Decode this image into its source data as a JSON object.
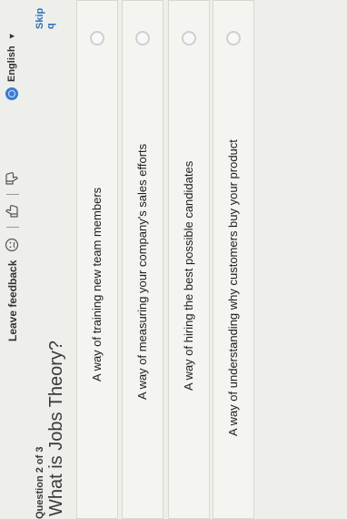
{
  "toolbar": {
    "feedback_label": "Leave feedback",
    "language_label": "English",
    "icons": [
      "confused-face-icon",
      "thumbs-up-icon",
      "thumbs-down-icon",
      "globe-icon",
      "chevron-down-icon"
    ]
  },
  "question": {
    "number_label": "Question 2 of 3",
    "title": "What is Jobs Theory?",
    "skip_label": "Skip q"
  },
  "options": [
    {
      "label": "A way of understanding why customers buy your product"
    },
    {
      "label": "A way of hiring the best possible candidates"
    },
    {
      "label": "A way of measuring your company's sales efforts"
    },
    {
      "label": "A way of training new team members"
    }
  ],
  "colors": {
    "background": "#eeeeea",
    "option_bg": "#f4f4f1",
    "accent": "#2e6fbf",
    "globe": "#3a7bd5"
  }
}
